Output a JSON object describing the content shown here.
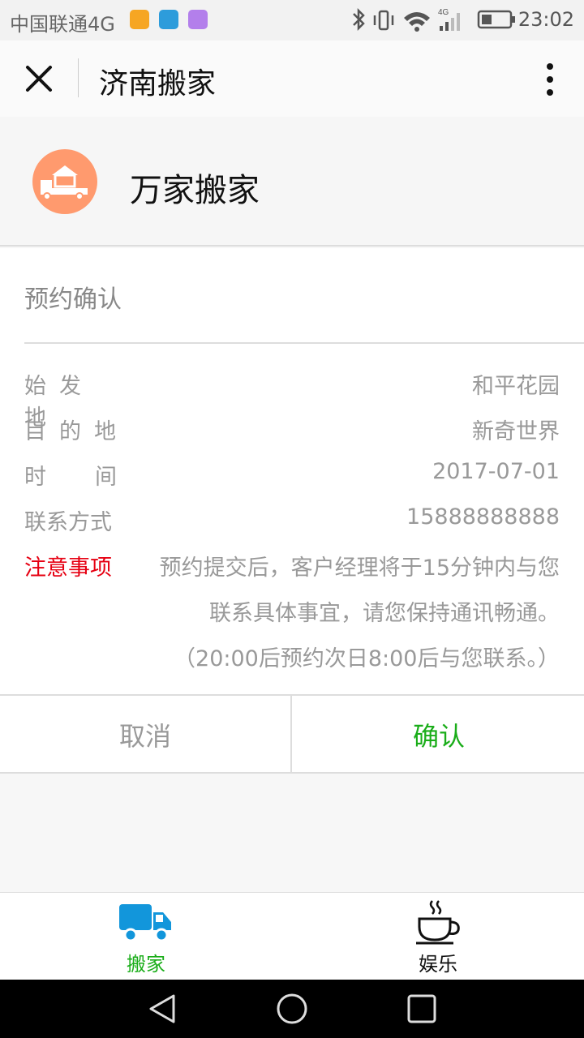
{
  "status_bar": {
    "carrier": "中国联通4G",
    "time": "23:02",
    "network": "4G"
  },
  "nav": {
    "title": "济南搬家"
  },
  "brand": {
    "name": "万家搬家",
    "logo_color": "#ff9a6e"
  },
  "booking": {
    "heading": "预约确认",
    "origin_label": "始发地",
    "origin_value": "和平花园",
    "destination_label": "目的地",
    "destination_value": "新奇世界",
    "time_label": "时间",
    "time_value": "2017-07-01",
    "contact_label": "联系方式",
    "contact_value": "15888888888",
    "notice_label": "注意事项",
    "notice_line1": "预约提交后，客户经理将于15分钟内与您",
    "notice_line2": "联系具体事宜，请您保持通讯畅通。",
    "notice_line3": "（20:00后预约次日8:00后与您联系。）"
  },
  "actions": {
    "cancel": "取消",
    "confirm": "确认",
    "confirm_color": "#1aad19"
  },
  "tabs": [
    {
      "label": "搬家",
      "icon": "truck-icon",
      "color": "#1aad19"
    },
    {
      "label": "娱乐",
      "icon": "coffee-cup-icon",
      "color": "#111111"
    }
  ],
  "colors": {
    "notice": "#e60012",
    "tab_icon_active": "#1296db"
  }
}
